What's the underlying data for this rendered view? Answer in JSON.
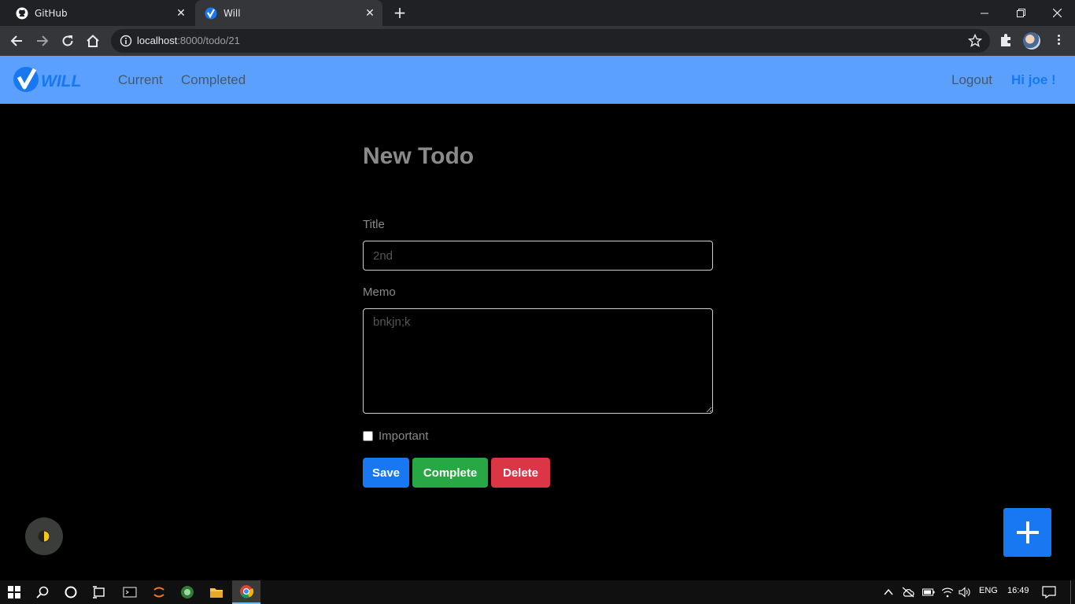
{
  "browser": {
    "tabs": [
      {
        "label": "GitHub",
        "icon": "github-icon"
      },
      {
        "label": "Will",
        "icon": "will-favicon"
      }
    ],
    "url_host": "localhost",
    "url_path": ":8000/todo/21"
  },
  "navbar": {
    "brand": "WILL",
    "links": [
      "Current",
      "Completed"
    ],
    "logout": "Logout",
    "greeting": "Hi joe !",
    "background": "#5aa0fc"
  },
  "form": {
    "heading": "New Todo",
    "title_label": "Title",
    "title_value": "2nd",
    "memo_label": "Memo",
    "memo_value": "bnkjn;k",
    "important_label": "Important",
    "important_checked": false
  },
  "buttons": {
    "save": "Save",
    "complete": "Complete",
    "delete": "Delete"
  },
  "colors": {
    "save": "#1778f2",
    "complete": "#28a745",
    "delete": "#dc3545",
    "fab": "#1778f2"
  },
  "taskbar": {
    "language": "ENG",
    "time": "16:49"
  }
}
